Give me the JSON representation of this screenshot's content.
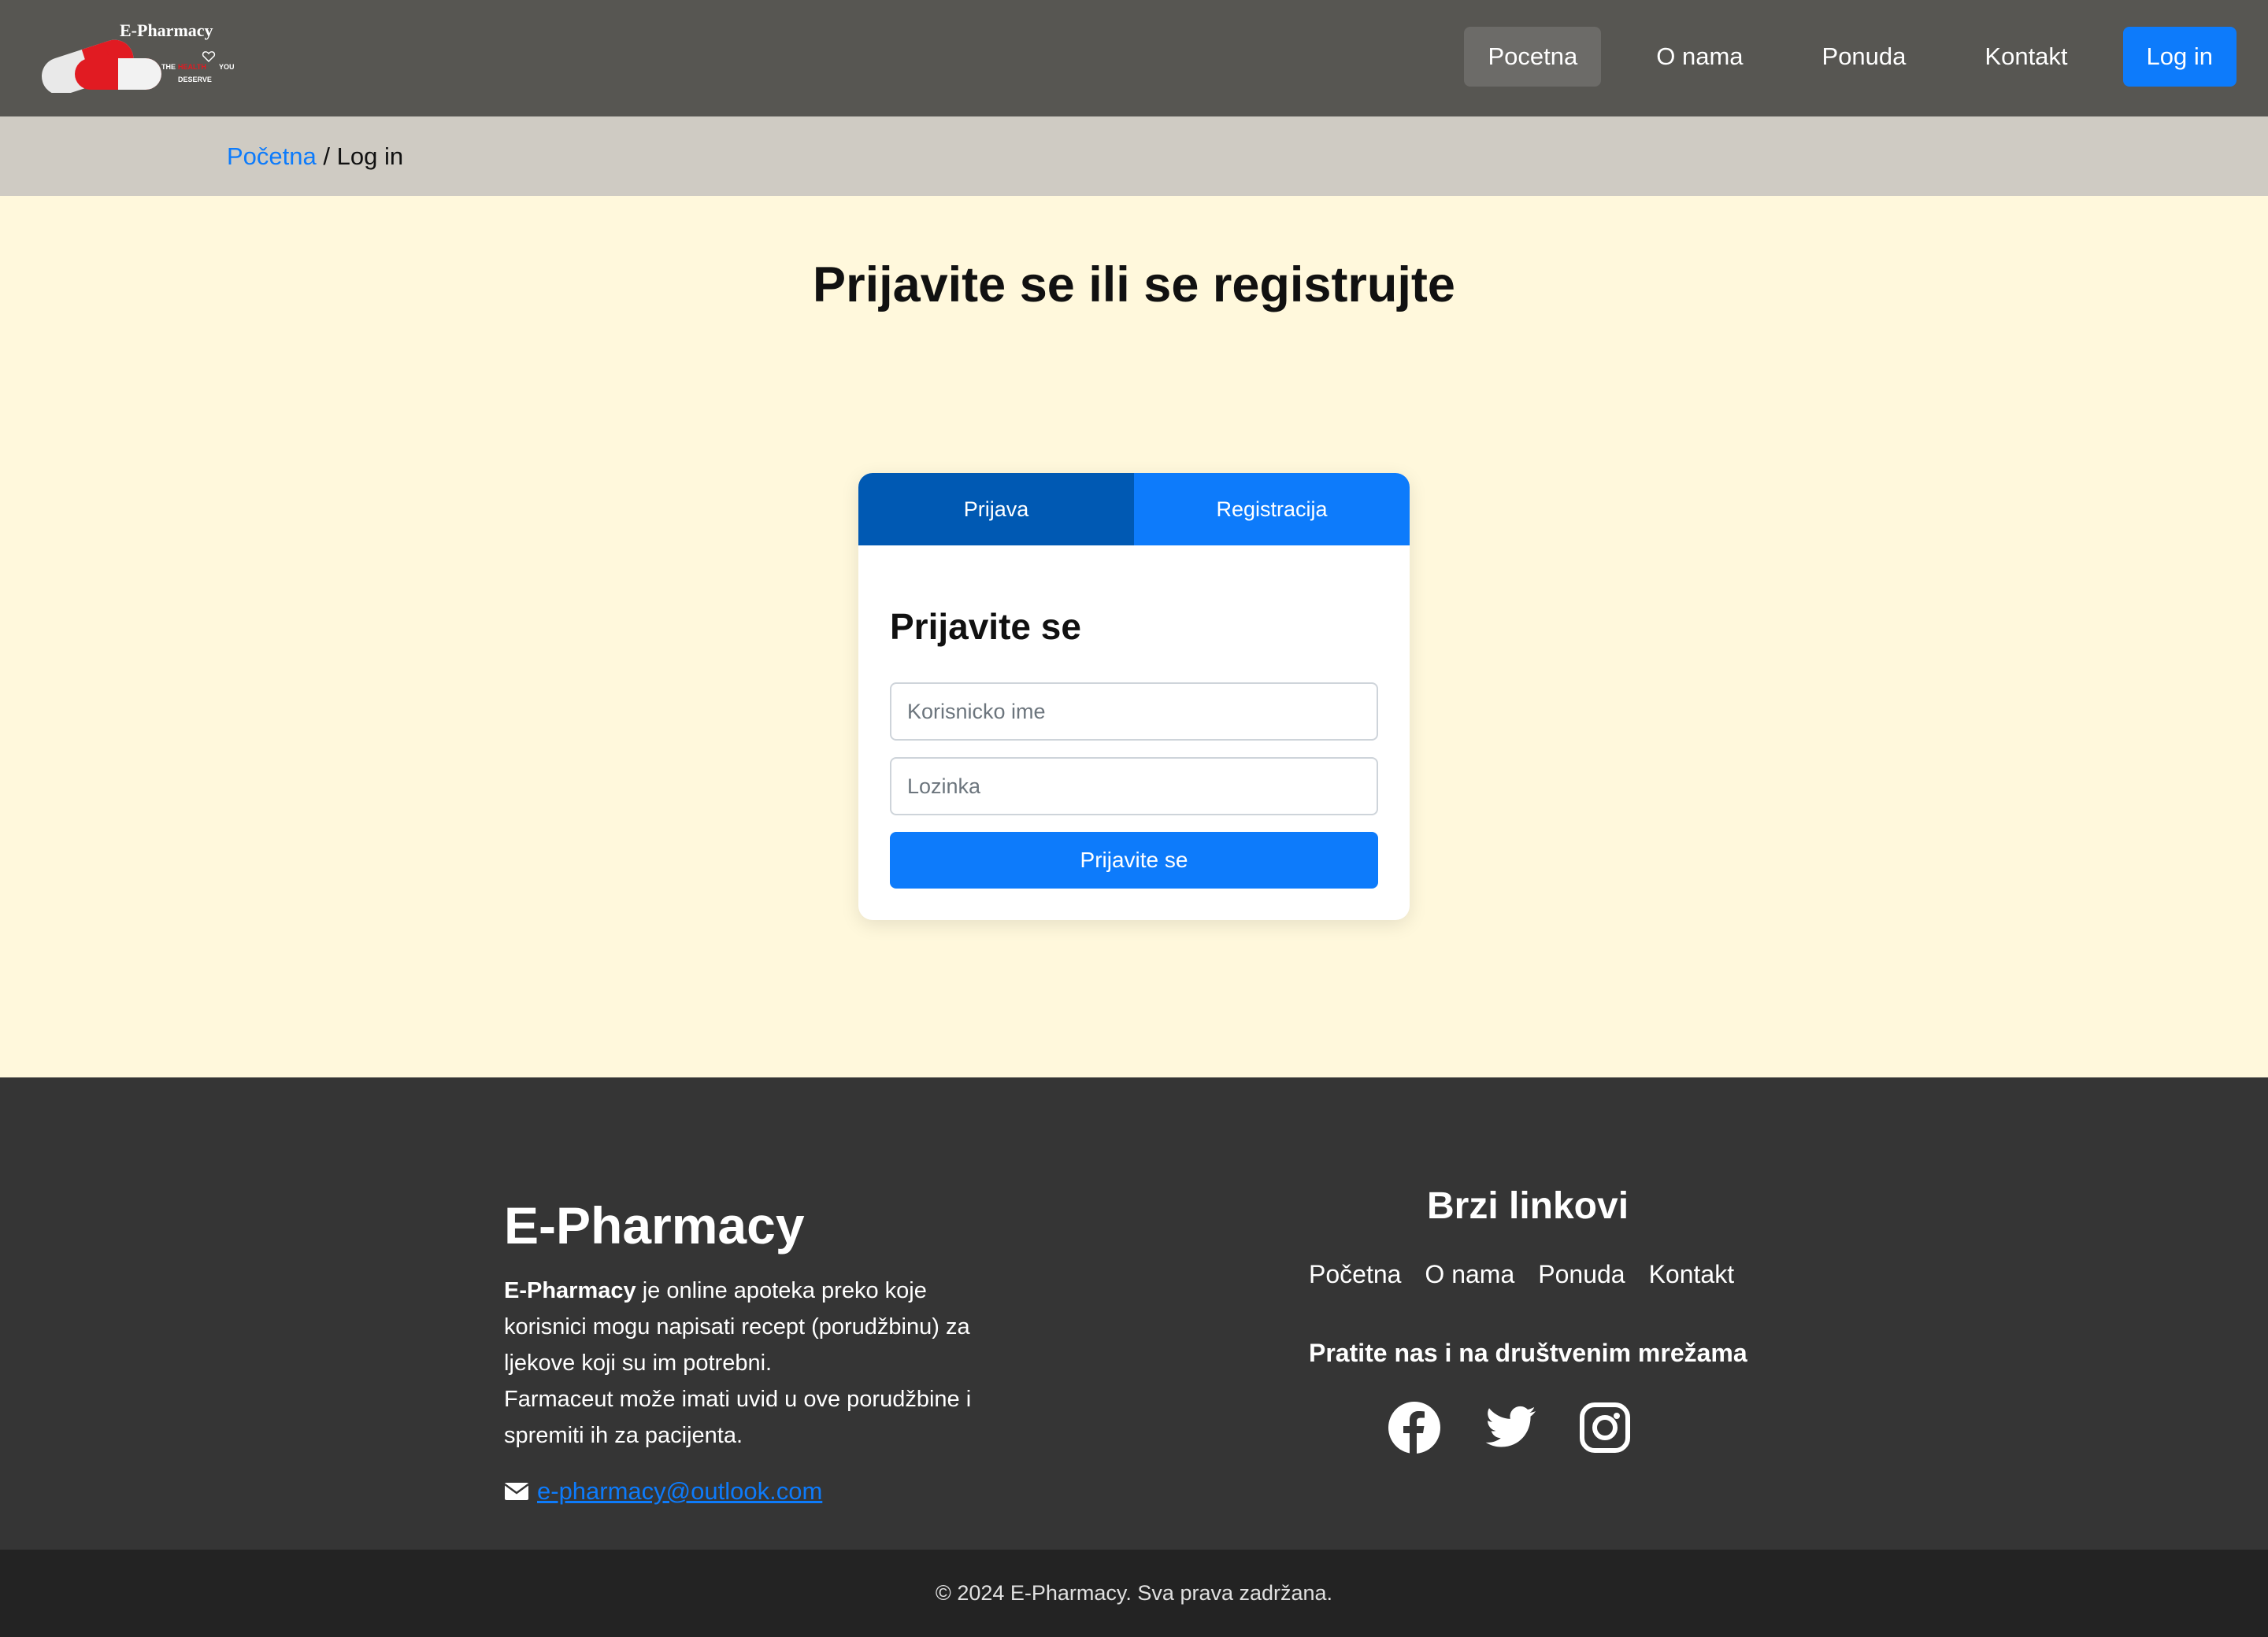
{
  "nav": {
    "logo": {
      "brand": "E-Pharmacy",
      "tagline_line1": "THE",
      "tagline_heart": "HEALTH",
      "tagline_you": "YOU",
      "tagline_line2": "DESERVE"
    },
    "links": [
      "Pocetna",
      "O nama",
      "Ponuda",
      "Kontakt"
    ],
    "login_label": "Log in"
  },
  "breadcrumb": {
    "home": "Početna",
    "separator": " / ",
    "current": "Log in"
  },
  "main": {
    "title": "Prijavite se ili se registrujte"
  },
  "auth_card": {
    "tabs": [
      "Prijava",
      "Registracija"
    ],
    "form_title": "Prijavite se",
    "username_placeholder": "Korisnicko ime",
    "password_placeholder": "Lozinka",
    "submit_label": "Prijavite se"
  },
  "footer": {
    "brand": "E-Pharmacy",
    "desc_bold": "E-Pharmacy",
    "desc_line1": " je online apoteka preko koje korisnici mogu napisati recept (porudžbinu) za ljekove koji su im potrebni.",
    "desc_line2": "Farmaceut može imati uvid u ove porudžbine i spremiti ih za pacijenta.",
    "email": "e-pharmacy@outlook.com",
    "quick_links_title": "Brzi linkovi",
    "quick_links": [
      "Početna",
      "O nama",
      "Ponuda",
      "Kontakt"
    ],
    "social_title": "Pratite nas i na društvenim mrežama",
    "social_icons": [
      "facebook-icon",
      "twitter-icon",
      "instagram-icon"
    ],
    "copyright": "© 2024 E-Pharmacy. Sva prava zadržana."
  },
  "colors": {
    "accent": "#0d7bfb",
    "nav_bg": "#575652",
    "page_bg": "#fff8dc",
    "footer_bg": "#353535"
  }
}
